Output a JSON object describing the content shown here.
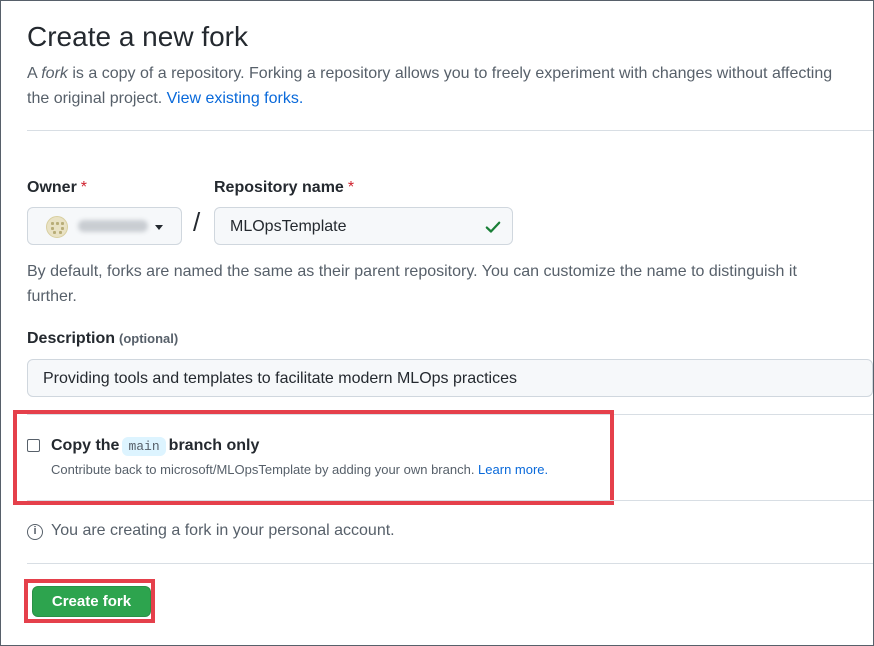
{
  "header": {
    "title": "Create a new fork",
    "intro_prefix": "A ",
    "intro_em": "fork",
    "intro_rest": " is a copy of a repository. Forking a repository allows you to freely experiment with changes without affecting the original project. ",
    "view_forks_link": "View existing forks."
  },
  "form": {
    "owner_label": "Owner",
    "repo_label": "Repository name",
    "required_mark": "*",
    "separator": "/",
    "repo_name_value": "MLOpsTemplate",
    "name_help": "By default, forks are named the same as their parent repository. You can customize the name to distinguish it further.",
    "description_label": "Description",
    "description_optional": "(optional)",
    "description_value": "Providing tools and templates to facilitate modern MLOps practices"
  },
  "copy_branch": {
    "checked": false,
    "label_prefix": "Copy the",
    "branch": "main",
    "label_suffix": "branch only",
    "note_text": "Contribute back to microsoft/MLOpsTemplate by adding your own branch. ",
    "learn_more": "Learn more."
  },
  "info": {
    "icon": "info-icon",
    "text": "You are creating a fork in your personal account."
  },
  "actions": {
    "create_fork": "Create fork"
  },
  "colors": {
    "accent_link": "#0969da",
    "required": "#cf222e",
    "primary_button": "#2da44e",
    "annotation_highlight": "#e5404b",
    "valid_check": "#1a7f37"
  }
}
